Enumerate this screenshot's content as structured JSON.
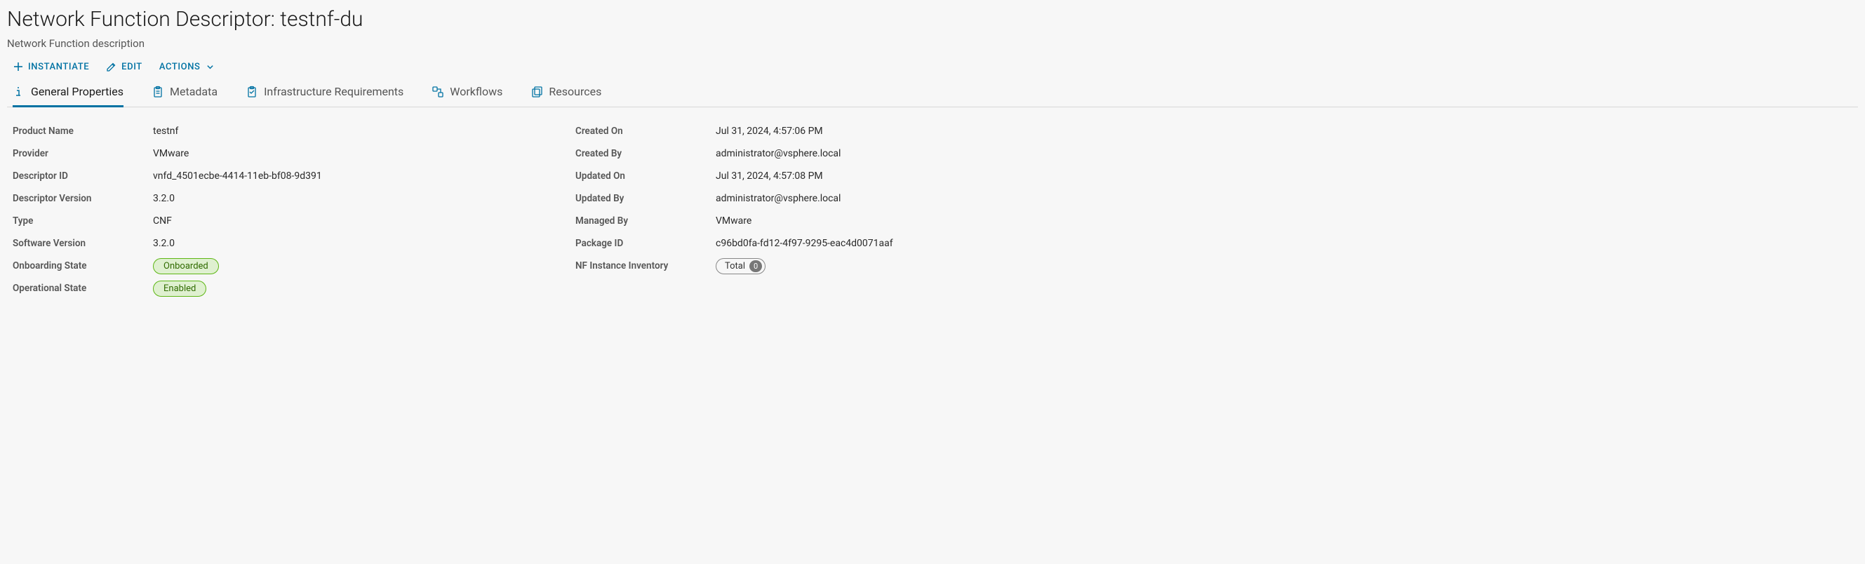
{
  "header": {
    "title_prefix": "Network Function Descriptor: ",
    "title_name": "testnf-du",
    "subtitle": "Network Function description"
  },
  "actions": {
    "instantiate": "INSTANTIATE",
    "edit": "EDIT",
    "actions": "ACTIONS"
  },
  "tabs": {
    "general": "General Properties",
    "metadata": "Metadata",
    "infra": "Infrastructure Requirements",
    "workflows": "Workflows",
    "resources": "Resources"
  },
  "left": {
    "product_name": {
      "label": "Product Name",
      "value": "testnf"
    },
    "provider": {
      "label": "Provider",
      "value": "VMware"
    },
    "descriptor_id": {
      "label": "Descriptor ID",
      "value": "vnfd_4501ecbe-4414-11eb-bf08-9d391"
    },
    "descriptor_version": {
      "label": "Descriptor Version",
      "value": "3.2.0"
    },
    "type": {
      "label": "Type",
      "value": "CNF"
    },
    "software_version": {
      "label": "Software Version",
      "value": "3.2.0"
    },
    "onboarding_state": {
      "label": "Onboarding State",
      "value": "Onboarded"
    },
    "operational_state": {
      "label": "Operational State",
      "value": "Enabled"
    }
  },
  "right": {
    "created_on": {
      "label": "Created On",
      "value": "Jul 31, 2024, 4:57:06 PM"
    },
    "created_by": {
      "label": "Created By",
      "value": "administrator@vsphere.local"
    },
    "updated_on": {
      "label": "Updated On",
      "value": "Jul 31, 2024, 4:57:08 PM"
    },
    "updated_by": {
      "label": "Updated By",
      "value": "administrator@vsphere.local"
    },
    "managed_by": {
      "label": "Managed By",
      "value": "VMware"
    },
    "package_id": {
      "label": "Package ID",
      "value": "c96bd0fa-fd12-4f97-9295-eac4d0071aaf"
    },
    "inventory": {
      "label": "NF Instance Inventory",
      "total_label": "Total",
      "count": "0"
    }
  }
}
